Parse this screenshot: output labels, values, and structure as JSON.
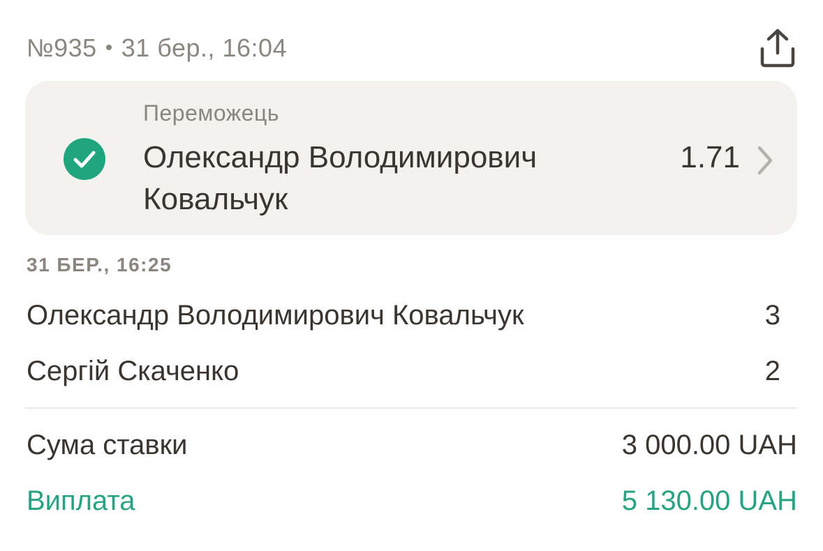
{
  "header": {
    "bet_number": "№935",
    "separator": "•",
    "date": "31 бер., 16:04",
    "share_icon": "share-icon"
  },
  "winner_card": {
    "label": "Переможець",
    "name": "Олександр Володимирович Ковальчук",
    "odds": "1.71",
    "status_icon": "check-circle-icon",
    "status_color": "#1fa67e",
    "nav_icon": "chevron-right-icon"
  },
  "result": {
    "date": "31 БЕР., 16:25",
    "rows": [
      {
        "name": "Олександр Володимирович Ковальчук",
        "score": "3"
      },
      {
        "name": "Сергій Скаченко",
        "score": "2"
      }
    ]
  },
  "summary": {
    "stake_label": "Сума ставки",
    "stake_value": "3 000.00 UAH",
    "payout_label": "Виплата",
    "payout_value": "5 130.00 UAH",
    "payout_color": "#26a383"
  }
}
